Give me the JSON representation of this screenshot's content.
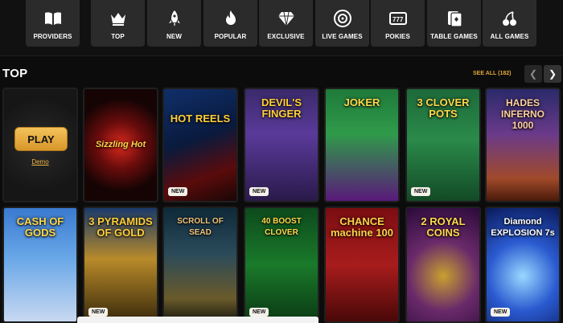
{
  "categories": [
    {
      "label": "PROVIDERS",
      "icon": "book-icon"
    },
    {
      "label": "TOP",
      "icon": "crown-icon"
    },
    {
      "label": "NEW",
      "icon": "rocket-icon"
    },
    {
      "label": "POPULAR",
      "icon": "flame-icon"
    },
    {
      "label": "EXCLUSIVE",
      "icon": "diamond-icon"
    },
    {
      "label": "LIVE GAMES",
      "icon": "roulette-icon"
    },
    {
      "label": "POKIES",
      "icon": "slot-machine-icon"
    },
    {
      "label": "TABLE GAMES",
      "icon": "cards-icon"
    },
    {
      "label": "ALL GAMES",
      "icon": "cherries-icon"
    }
  ],
  "section": {
    "title": "TOP",
    "see_all": "SEE ALL (182)",
    "prev_icon": "chevron-left-icon",
    "next_icon": "chevron-right-icon"
  },
  "featured": {
    "play_label": "PLAY",
    "demo_label": "Demo"
  },
  "games_row1": [
    {
      "title": "Sizzling Hot",
      "badge": ""
    },
    {
      "title": "HOT REELS",
      "badge": "NEW"
    },
    {
      "title": "DEVIL'S FINGER",
      "badge": "NEW"
    },
    {
      "title": "JOKER",
      "badge": ""
    },
    {
      "title": "3 CLOVER POTS",
      "badge": "NEW"
    },
    {
      "title": "HADES INFERNO 1000",
      "badge": ""
    }
  ],
  "games_row2": [
    {
      "title": "CASH OF GODS",
      "badge": ""
    },
    {
      "title": "3 PYRAMIDS OF GOLD",
      "badge": "NEW"
    },
    {
      "title": "SCROLL OF SEAD",
      "badge": ""
    },
    {
      "title": "40 BOOST CLOVER",
      "badge": "NEW"
    },
    {
      "title": "CHANCE machine 100",
      "badge": ""
    },
    {
      "title": "2 ROYAL COINS",
      "badge": ""
    },
    {
      "title": "Diamond EXPLOSION 7s",
      "badge": "NEW"
    }
  ],
  "colors": {
    "accent": "#e0a83a",
    "tile_bg": "#2b2b2b"
  }
}
